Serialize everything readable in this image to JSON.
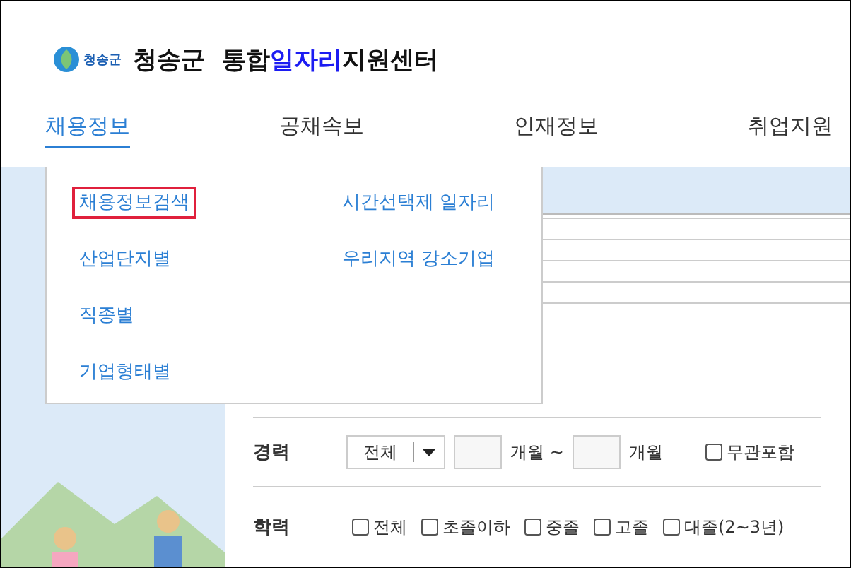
{
  "logo": {
    "text": "청송군"
  },
  "title": [
    {
      "text": "청송군  통합",
      "highlight": false
    },
    {
      "text": "일자리",
      "highlight": true
    },
    {
      "text": "지원센터",
      "highlight": false
    }
  ],
  "nav": [
    {
      "label": "채용정보",
      "selected": true
    },
    {
      "label": "공채속보",
      "selected": false
    },
    {
      "label": "인재정보",
      "selected": false
    },
    {
      "label": "취업지원",
      "selected": false
    }
  ],
  "menu": {
    "columns": [
      [
        {
          "label": "채용정보검색",
          "selected": true
        },
        {
          "label": "산업단지별",
          "selected": false
        },
        {
          "label": "직종별",
          "selected": false
        },
        {
          "label": "기업형태별",
          "selected": false
        }
      ],
      [
        {
          "label": "시간선택제 일자리",
          "selected": false
        },
        {
          "label": "우리지역 강소기업",
          "selected": false
        }
      ]
    ]
  },
  "experience": {
    "label": "경력",
    "select": "전체",
    "from_unit": "개월 ~",
    "to_unit": "개월",
    "option": {
      "label": "무관포함",
      "checked": false
    }
  },
  "education": {
    "label": "학력",
    "options": [
      {
        "label": "전체",
        "checked": false
      },
      {
        "label": "초졸이하",
        "checked": false
      },
      {
        "label": "중졸",
        "checked": false
      },
      {
        "label": "고졸",
        "checked": false
      },
      {
        "label": "대졸(2~3년)",
        "checked": false
      }
    ]
  }
}
